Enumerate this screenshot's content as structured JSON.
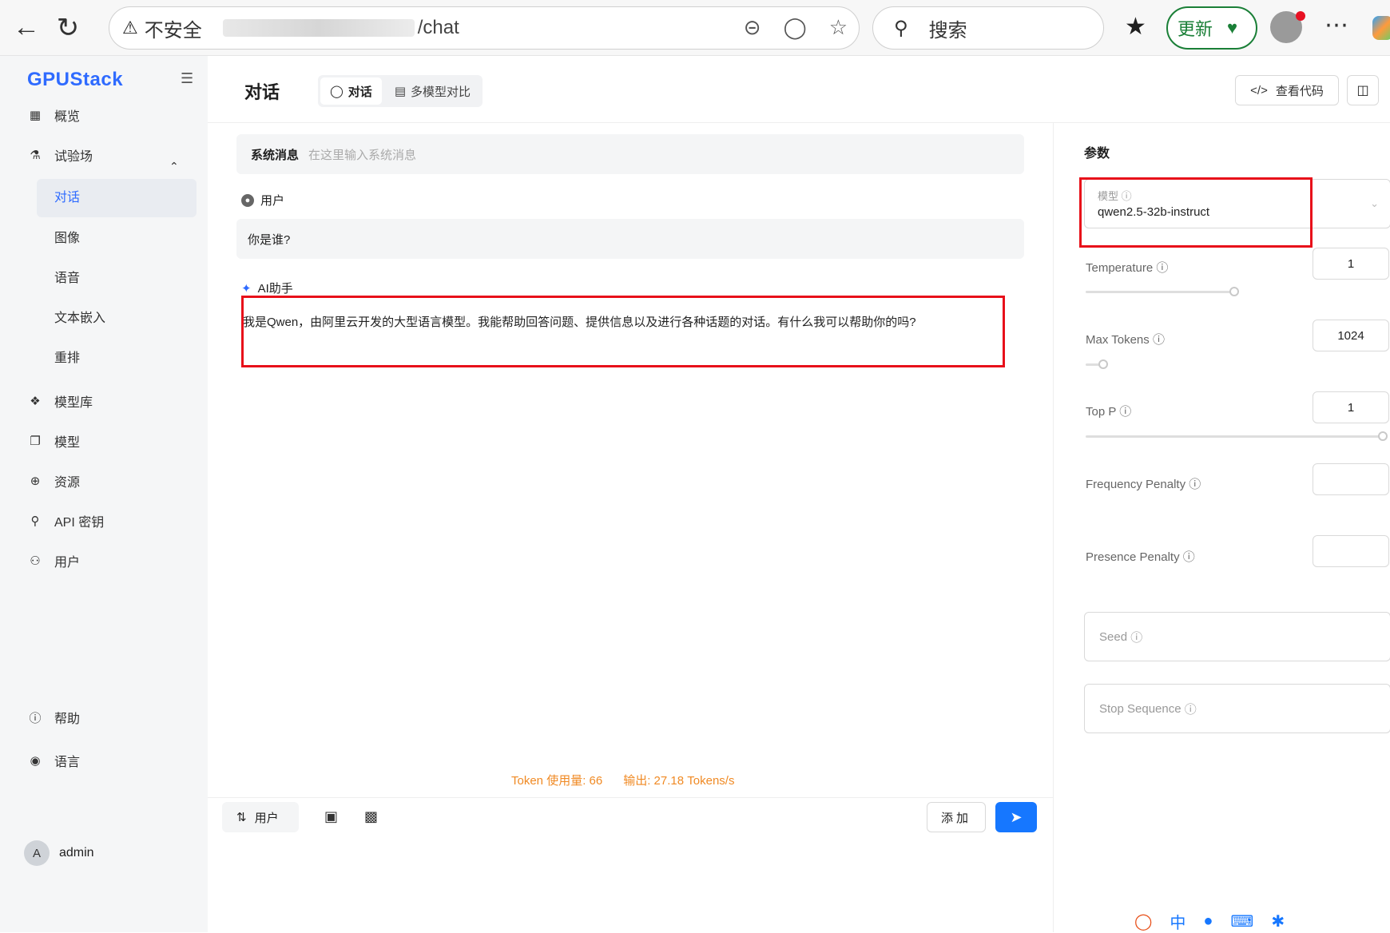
{
  "browser": {
    "security_label": "不安全",
    "url_fragment": "/chat",
    "search_placeholder": "搜索",
    "update_label": "更新"
  },
  "sidebar": {
    "logo": "GPUStack",
    "items": [
      {
        "label": "概览"
      },
      {
        "label": "试验场"
      },
      {
        "label": "对话"
      },
      {
        "label": "图像"
      },
      {
        "label": "语音"
      },
      {
        "label": "文本嵌入"
      },
      {
        "label": "重排"
      },
      {
        "label": "模型库"
      },
      {
        "label": "模型"
      },
      {
        "label": "资源"
      },
      {
        "label": "API 密钥"
      },
      {
        "label": "用户"
      }
    ],
    "bottom": [
      {
        "label": "帮助"
      },
      {
        "label": "语言"
      }
    ],
    "user": {
      "initial": "A",
      "name": "admin"
    }
  },
  "header": {
    "title": "对话",
    "tabs": [
      {
        "label": "对话"
      },
      {
        "label": "多模型对比"
      }
    ],
    "view_code_label": "查看代码"
  },
  "chat": {
    "system_label": "系统消息",
    "system_placeholder": "在这里输入系统消息",
    "user_role": "用户",
    "user_message": "你是谁?",
    "ai_role": "AI助手",
    "ai_message": "我是Qwen，由阿里云开发的大型语言模型。我能帮助回答问题、提供信息以及进行各种话题的对话。有什么我可以帮助你的吗?",
    "token_usage": "Token 使用量: 66",
    "output_speed": "输出: 27.18 Tokens/s",
    "role_switch_label": "用户",
    "add_label": "添加"
  },
  "params": {
    "title": "参数",
    "model_label": "模型",
    "model_value": "qwen2.5-32b-instruct",
    "temperature_label": "Temperature",
    "temperature_value": "1",
    "max_tokens_label": "Max Tokens",
    "max_tokens_value": "1024",
    "top_p_label": "Top P",
    "top_p_value": "1",
    "frequency_penalty_label": "Frequency Penalty",
    "presence_penalty_label": "Presence Penalty",
    "seed_label": "Seed",
    "stop_sequence_label": "Stop Sequence"
  },
  "colors": {
    "accent": "#1677ff",
    "highlight_box": "#e8101a",
    "token_info": "#f08a24"
  }
}
